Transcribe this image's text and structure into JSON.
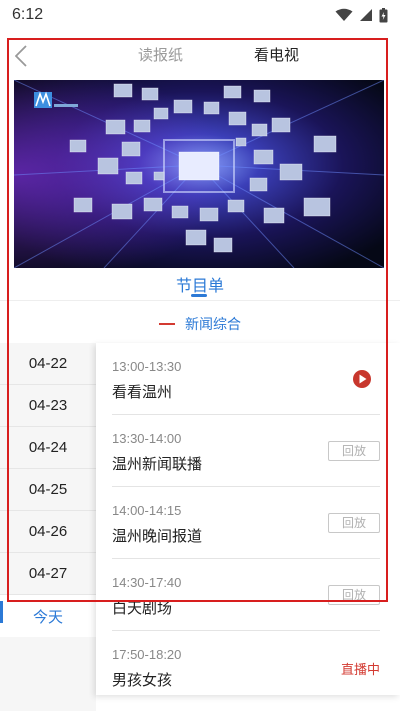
{
  "status_bar": {
    "time": "6:12",
    "icons": [
      "wifi-icon",
      "signal-icon",
      "battery-icon"
    ]
  },
  "header": {
    "back_icon": "chevron-left-icon",
    "tabs": [
      {
        "label": "读报纸",
        "active": false
      },
      {
        "label": "看电视",
        "active": true
      }
    ]
  },
  "video": {
    "logo_icon": "channel-logo-icon"
  },
  "schedule": {
    "title": "节目单",
    "channel": "新闻综合"
  },
  "dates": [
    {
      "label": "04-22",
      "active": false
    },
    {
      "label": "04-23",
      "active": false
    },
    {
      "label": "04-24",
      "active": false
    },
    {
      "label": "04-25",
      "active": false
    },
    {
      "label": "04-26",
      "active": false
    },
    {
      "label": "04-27",
      "active": false
    },
    {
      "label": "今天",
      "active": true
    }
  ],
  "programs": [
    {
      "time": "13:00-13:30",
      "name": "看看温州",
      "action": "play",
      "action_icon": "play-circle-icon"
    },
    {
      "time": "13:30-14:00",
      "name": "温州新闻联播",
      "action": "replay",
      "action_label": "回放"
    },
    {
      "time": "14:00-14:15",
      "name": "温州晚间报道",
      "action": "replay",
      "action_label": "回放"
    },
    {
      "time": "14:30-17:40",
      "name": "白天剧场",
      "action": "replay",
      "action_label": "回放"
    },
    {
      "time": "17:50-18:20",
      "name": "男孩女孩",
      "action": "live",
      "action_label": "直播中"
    }
  ],
  "colors": {
    "accent_blue": "#2b79d6",
    "accent_red": "#d33a31",
    "highlight_frame": "#d81e1e"
  }
}
